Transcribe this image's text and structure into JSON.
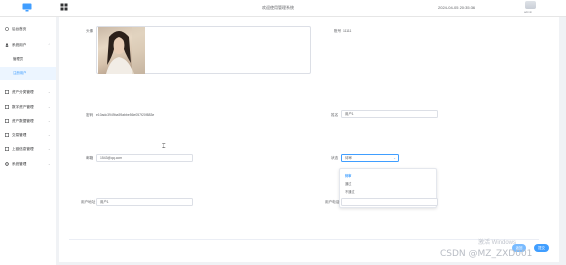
{
  "header": {
    "system_title": "欢迎使用管理系统",
    "datetime": "2024-04-05 20:35:36",
    "user_label": "admin"
  },
  "sidebar": {
    "items": [
      {
        "label": "后台首页",
        "icon": "home-icon"
      },
      {
        "label": "系统用户",
        "icon": "person-icon",
        "expanded": true
      },
      {
        "label": "管理员"
      },
      {
        "label": "注册用户",
        "active": true
      },
      {
        "label": "资产分类管理",
        "icon": "grid-icon"
      },
      {
        "label": "数字资产管理",
        "icon": "grid-icon"
      },
      {
        "label": "资产数据管理",
        "icon": "grid-icon"
      },
      {
        "label": "交易管理",
        "icon": "grid-icon"
      },
      {
        "label": "上链信息管理",
        "icon": "grid-icon"
      },
      {
        "label": "系统管理",
        "icon": "gear-icon"
      }
    ]
  },
  "form": {
    "avatar_label": "头像",
    "account_label": "账号",
    "account_value": "11111",
    "password_label": "密码",
    "password_value": "e10adc3949ba59abbe56e057f20f883e",
    "name_label": "姓名",
    "name_value": "用户1",
    "email_label": "邮箱",
    "email_value": "1543@qq.com",
    "status_label": "状态",
    "status_value": "待审",
    "status_options": [
      "待审",
      "通过",
      "不通过",
      "已注销"
    ],
    "address_label": "用户地址",
    "address_value": "用户1",
    "phone_label": "用户电话",
    "phone_value": ""
  },
  "actions": {
    "back": "返回",
    "submit": "提交"
  },
  "watermark": {
    "line1": "激活 Windows",
    "line2": "CSDN @MZ_ZXD001"
  },
  "colors": {
    "primary": "#409eff",
    "sidebar_active_bg": "#ecf5ff",
    "page_bg": "#f0f2f5"
  }
}
